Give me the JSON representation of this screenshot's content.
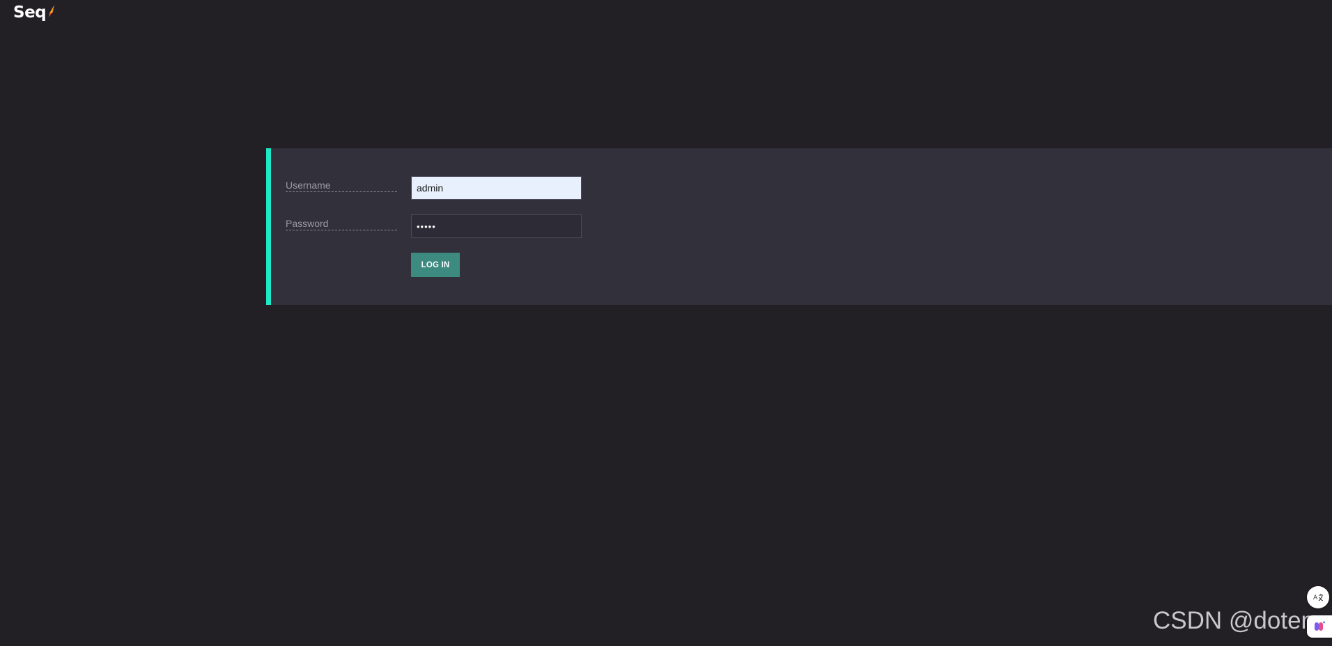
{
  "app": {
    "logo_text": "Seq",
    "accent_color": "#1de9c8",
    "button_color": "#3d8a80",
    "background_color": "#221f25",
    "panel_color": "#31303b"
  },
  "login": {
    "username_label": "Username",
    "username_value": "admin",
    "password_label": "Password",
    "password_value": "•••••",
    "login_button_label": "LOG IN"
  },
  "overlay": {
    "watermark_text": "CSDN @doten",
    "translate_icon": "translate-icon",
    "assistant_icon": "assistant-icon"
  }
}
